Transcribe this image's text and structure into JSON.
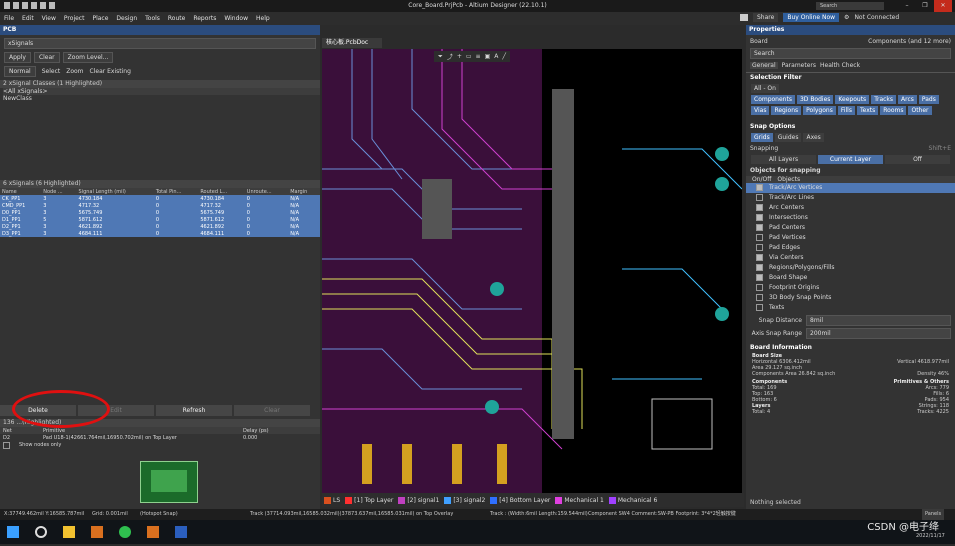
{
  "window": {
    "title": "Core_Board.PrjPcb - Altium Designer (22.10.1)",
    "search_placeholder": "Search",
    "minimize": "–",
    "maximize": "❐",
    "close": "✕"
  },
  "menu": {
    "items": [
      "File",
      "Edit",
      "View",
      "Project",
      "Place",
      "Design",
      "Tools",
      "Route",
      "Reports",
      "Window",
      "Help"
    ],
    "share": "Share",
    "buy": "Buy Online Now",
    "not_connected": "Not Connected"
  },
  "pcb_panel": {
    "title": "PCB",
    "mode": "xSignals",
    "apply": "Apply",
    "clear": "Clear",
    "zoom_level": "Zoom Level...",
    "normal": "Normal",
    "select_label": "Select",
    "zoom_label": "Zoom",
    "clear_existing_label": "Clear Existing",
    "classes_header": "2 xSignal Classes (1 Highlighted)",
    "classes": [
      "<All xSignals>",
      "NewClass"
    ],
    "signals_header": "6 xSignals (6 Highlighted)",
    "columns": [
      "Name",
      "Node ...",
      "Signal Length (mil)",
      "Total Pin...",
      "Routed L...",
      "Unroute...",
      "Margin"
    ],
    "rows": [
      [
        "CK_PP1",
        "3",
        "4730.184",
        "0",
        "4730.184",
        "0",
        "N/A"
      ],
      [
        "CMD_PP1",
        "3",
        "4717.32",
        "0",
        "4717.32",
        "0",
        "N/A"
      ],
      [
        "D0_PP1",
        "3",
        "5675.749",
        "0",
        "5675.749",
        "0",
        "N/A"
      ],
      [
        "D1_PP1",
        "5",
        "5871.612",
        "0",
        "5871.612",
        "0",
        "N/A"
      ],
      [
        "D2_PP1",
        "3",
        "4621.892",
        "0",
        "4621.892",
        "0",
        "N/A"
      ],
      [
        "D3_PP1",
        "3",
        "4684.111",
        "0",
        "4684.111",
        "0",
        "N/A"
      ]
    ],
    "delete": "Delete",
    "edit": "Edit",
    "refresh": "Refresh",
    "clear_filter": "Clear",
    "bottom_header": "136 ...(Highlighted)",
    "bottom_columns": [
      "Net",
      "Primitive",
      "Delay (ps)"
    ],
    "bottom_row": [
      "D2",
      "Pad U18-1(42661.764mil,16950.702mil) on Top Layer",
      "0.000"
    ],
    "show_nodes_only": "Show nodes only"
  },
  "document": {
    "tab": "核心板.PcbDoc"
  },
  "layers": [
    {
      "name": "LS",
      "color": "#d9501f"
    },
    {
      "name": "[1] Top Layer",
      "color": "#ff3030"
    },
    {
      "name": "[2] signal1",
      "color": "#c040c0"
    },
    {
      "name": "[3] signal2",
      "color": "#40a0ff"
    },
    {
      "name": "[4] Bottom Layer",
      "color": "#2f6fff"
    },
    {
      "name": "Mechanical 1",
      "color": "#e040e0"
    },
    {
      "name": "Mechanical 6",
      "color": "#a040ff"
    },
    {
      "name": "Mechanical 13",
      "color": "#ff40c0"
    },
    {
      "name": "Mechanical 15",
      "color": "#40c040"
    }
  ],
  "properties": {
    "title": "Properties",
    "board": "Board",
    "components_filter": "Components (and 12 more)",
    "search_placeholder": "Search",
    "tabs": [
      "General",
      "Parameters",
      "Health Check"
    ],
    "selection_filter_title": "Selection Filter",
    "all_on": "All - On",
    "filters": [
      "Components",
      "3D Bodies",
      "Keepouts",
      "Tracks",
      "Arcs",
      "Pads",
      "Vias",
      "Regions",
      "Polygons",
      "Fills",
      "Texts",
      "Rooms",
      "Other"
    ],
    "snap_options_title": "Snap Options",
    "snap_tabs": [
      "Grids",
      "Guides",
      "Axes"
    ],
    "snapping_label": "Snapping",
    "snapping_hint": "Shift+E",
    "snapping_modes": [
      "All Layers",
      "Current Layer",
      "Off"
    ],
    "objects_for_snapping": "Objects for snapping",
    "onoff_col": "On/Off",
    "objects_col": "Objects",
    "snap_objects": [
      {
        "name": "Track/Arc Vertices",
        "on": true
      },
      {
        "name": "Track/Arc Lines",
        "on": false
      },
      {
        "name": "Arc Centers",
        "on": true
      },
      {
        "name": "Intersections",
        "on": true
      },
      {
        "name": "Pad Centers",
        "on": true
      },
      {
        "name": "Pad Vertices",
        "on": false
      },
      {
        "name": "Pad Edges",
        "on": false
      },
      {
        "name": "Via Centers",
        "on": true
      },
      {
        "name": "Regions/Polygons/Fills",
        "on": true
      },
      {
        "name": "Board Shape",
        "on": true
      },
      {
        "name": "Footprint Origins",
        "on": false
      },
      {
        "name": "3D Body Snap Points",
        "on": false
      },
      {
        "name": "Texts",
        "on": false
      }
    ],
    "snap_distance_label": "Snap Distance",
    "snap_distance": "8mil",
    "axis_snap_label": "Axis Snap Range",
    "axis_snap": "200mil",
    "board_info_title": "Board Information",
    "board_size_label": "Board Size",
    "horizontal_label": "Horizontal",
    "horizontal": "6306.412mil",
    "vertical_label": "Vertical",
    "vertical": "4618.977mil",
    "area_label": "Area",
    "area": "29.127 sq.inch",
    "comp_area_label": "Components Area",
    "comp_area": "26.842 sq.inch",
    "density_label": "Density",
    "density": "46%",
    "components_label": "Components",
    "prims_label": "Primitives & Others",
    "total_label": "Total:",
    "total": "169",
    "top_label": "Top:",
    "top": "163",
    "bottom_label": "Bottom:",
    "bottom": "6",
    "arcs_label": "Arcs:",
    "arcs": "779",
    "fills_label": "Fills:",
    "fills": "6",
    "pads_label": "Pads:",
    "pads": "954",
    "strings_label": "Strings:",
    "strings": "118",
    "tracks_label": "Tracks:",
    "tracks": "4225",
    "layers_label": "Layers",
    "layers_total": "4",
    "nothing_selected": "Nothing selected"
  },
  "status": {
    "coords": "X:37749.462mil Y:16585.787mil",
    "grid": "Grid: 0.001mil",
    "snap": "(Hotspot Snap)",
    "track_info": "Track (37714.093mil,16585.032mil)(37873.637mil,16585.031mil) on Top Overlay",
    "track_detail": "Track : (Width:6mil Length:159.544mil)",
    "component": "Component SW4 Comment:SW-PB Footprint: 3*4*2轻触按键",
    "panels": "Panels"
  },
  "taskbar": {
    "watermark": "CSDN @电子绛",
    "date": "2022/11/17"
  }
}
